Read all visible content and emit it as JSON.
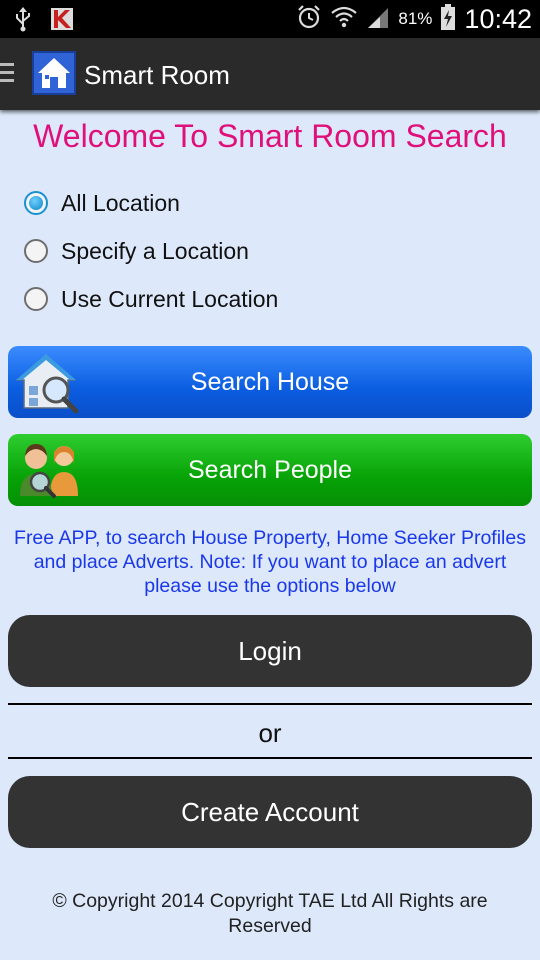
{
  "status_bar": {
    "battery_percent": "81%",
    "time": "10:42",
    "icons": [
      "usb-icon",
      "app-notification-icon",
      "alarm-icon",
      "wifi-icon",
      "signal-icon",
      "battery-icon"
    ]
  },
  "action_bar": {
    "title": "Smart Room",
    "icons": [
      "menu-icon",
      "house-logo-icon"
    ]
  },
  "main": {
    "welcome": "Welcome To Smart Room Search",
    "location_options": [
      {
        "label": "All Location",
        "checked": true
      },
      {
        "label": "Specify a Location",
        "checked": false
      },
      {
        "label": "Use Current Location",
        "checked": false
      }
    ],
    "search_house_label": "Search House",
    "search_people_label": "Search People",
    "info_text": "Free APP, to search House Property, Home Seeker Profiles and place Adverts. Note: If you want to place an advert please use the options below",
    "login_label": "Login",
    "or_label": "or",
    "create_account_label": "Create Account",
    "copyright": "© Copyright 2014 Copyright TAE Ltd All Rights are Reserved"
  },
  "colors": {
    "welcome": "#e0107a",
    "info_text": "#1a38e8",
    "search_house": "#0b5de0",
    "search_people": "#07a307",
    "dark_button": "#333333",
    "background": "#dde9fb"
  }
}
